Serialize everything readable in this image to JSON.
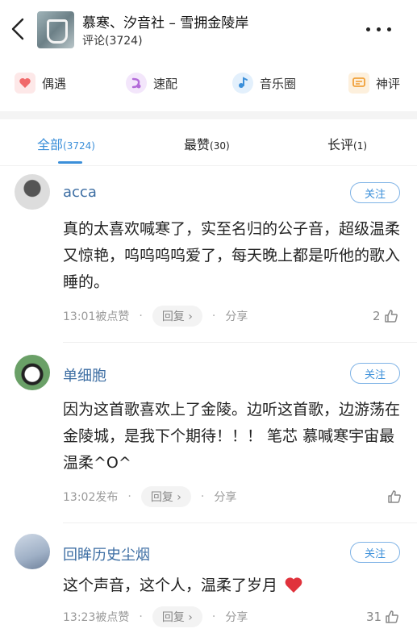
{
  "header": {
    "song_title": "慕寒、汐音社 – 雪拥金陵岸",
    "comment_count_label": "评论(3724)"
  },
  "shortcuts": [
    {
      "label": "偶遇",
      "icon": "encounter-icon",
      "color": "#f0696a"
    },
    {
      "label": "速配",
      "icon": "quick-match-icon",
      "color": "#b36ad9"
    },
    {
      "label": "音乐圈",
      "icon": "music-circle-icon",
      "color": "#3b8fd9"
    },
    {
      "label": "神评",
      "icon": "top-comment-icon",
      "color": "#f1a13a"
    }
  ],
  "tabs": [
    {
      "label": "全部",
      "count": "(3724)",
      "active": true
    },
    {
      "label": "最赞",
      "count": "(30)",
      "active": false
    },
    {
      "label": "长评",
      "count": "(1)",
      "active": false
    }
  ],
  "comments": [
    {
      "user": "acca",
      "follow": "关注",
      "text": "真的太喜欢喊寒了，实至名归的公子音，超级温柔又惊艳，呜呜呜呜爱了，每天晚上都是听他的歌入睡的。",
      "time": "13:01被点赞",
      "reply": "回复 ›",
      "share": "分享",
      "likes": "2"
    },
    {
      "user": "单细胞",
      "follow": "关注",
      "text": "因为这首歌喜欢上了金陵。边听这首歌，边游荡在金陵城，是我下个期待！！！ 笔芯  慕喊寒宇宙最温柔^O^",
      "time": "13:02发布",
      "reply": "回复 ›",
      "share": "分享",
      "likes": ""
    },
    {
      "user": "回眸历史尘烟",
      "follow": "关注",
      "text": "这个声音，这个人，温柔了岁月",
      "time": "13:23被点赞",
      "reply": "回复 ›",
      "share": "分享",
      "likes": "31"
    }
  ],
  "colors": {
    "accent": "#3b8fd9",
    "username": "#3d6ea3",
    "heart": "#e0323c"
  }
}
